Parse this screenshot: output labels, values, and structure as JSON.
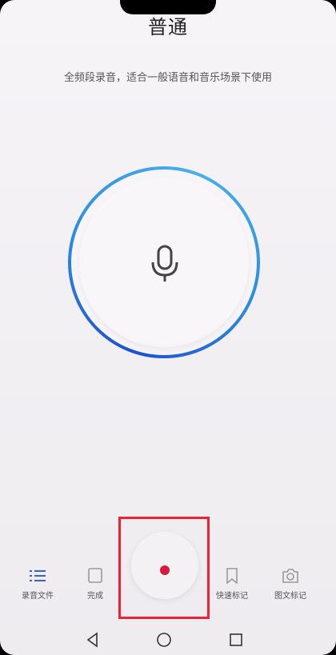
{
  "header": {
    "title": "普通",
    "subtitle": "全频段录音，适合一般语音和音乐场景下使用"
  },
  "mic": {
    "icon": "microphone-icon"
  },
  "toolbar": {
    "files_label": "录音文件",
    "done_label": "完成",
    "quick_mark_label": "快速标记",
    "photo_mark_label": "图文标记"
  },
  "record": {
    "icon": "record-dot-icon",
    "color": "#d8193b"
  },
  "highlight_color": "#ee2233",
  "accent_color": "#2b8fe0",
  "nav": {
    "back": "back-triangle-icon",
    "home": "home-circle-icon",
    "recents": "recents-square-icon"
  }
}
